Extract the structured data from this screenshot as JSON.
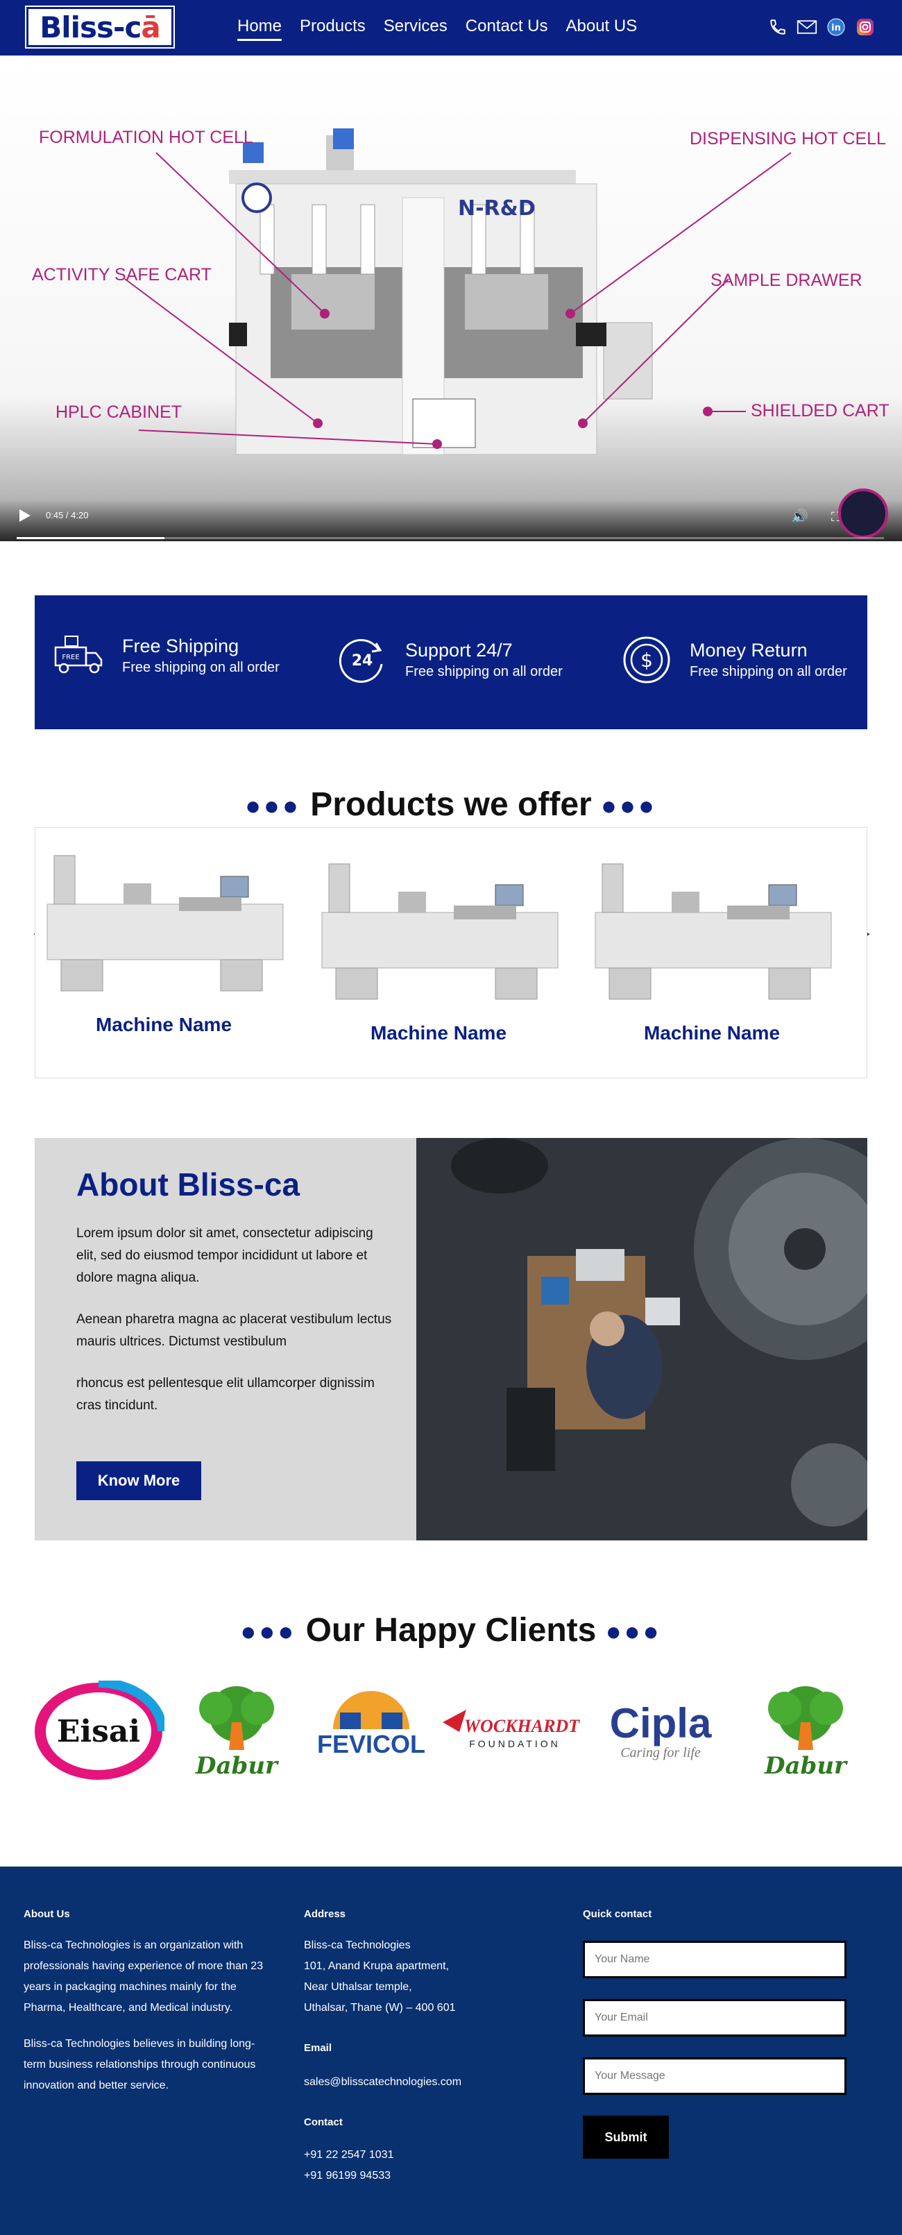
{
  "nav": {
    "logo_main": "Bliss-c",
    "logo_accent": "ā",
    "items": [
      "Home",
      "Products",
      "Services",
      "Contact Us",
      "About US"
    ],
    "active_index": 0,
    "icons": [
      "phone-icon",
      "mail-icon",
      "linkedin-icon",
      "instagram-icon"
    ]
  },
  "hero": {
    "callouts": [
      "FORMULATION HOT CELL",
      "DISPENSING HOT CELL",
      "ACTIVITY SAFE CART",
      "SAMPLE DRAWER",
      "HPLC CABINET",
      "SHIELDED CART"
    ],
    "machine_label": "N-R&D",
    "video_time": "0:45 / 4:20",
    "video_progress": 0.17
  },
  "features": [
    {
      "title": "Free Shipping",
      "sub": "Free shipping on all order",
      "icon": "truck-icon"
    },
    {
      "title": "Support 24/7",
      "sub": "Free shipping on all order",
      "icon": "support-24-icon"
    },
    {
      "title": "Money Return",
      "sub": "Free shipping on all order",
      "icon": "money-return-icon"
    }
  ],
  "products": {
    "title": "Products we offer",
    "items": [
      "Machine Name",
      "Machine Name",
      "Machine Name"
    ]
  },
  "about": {
    "title": "About Bliss-ca",
    "paragraphs": [
      "Lorem ipsum dolor sit amet, consectetur adipiscing elit, sed do eiusmod tempor incididunt ut labore et dolore magna aliqua.",
      "Aenean pharetra magna ac placerat vestibulum lectus mauris ultrices. Dictumst vestibulum",
      "rhoncus est pellentesque elit ullamcorper dignissim cras tincidunt."
    ],
    "button": "Know More"
  },
  "clients": {
    "title": "Our Happy Clients",
    "logos": [
      "Eisai",
      "Dabur",
      "FEVICOL",
      "WOCKHARDT",
      "FOUNDATION",
      "Cipla",
      "Caring for life",
      "Dabur"
    ]
  },
  "footer": {
    "about_head": "About Us",
    "about_p1": "Bliss-ca Technologies is an organization with professionals having experience of more than 23 years in packaging machines mainly for the Pharma, Healthcare, and Medical industry.",
    "about_p2": "Bliss-ca Technologies believes in building long-term business relationships through continuous innovation and better service.",
    "address_head": "Address",
    "address_lines": [
      "Bliss-ca Technologies",
      "101, Anand Krupa apartment,",
      "Near Uthalsar temple,",
      "Uthalsar, Thane (W) – 400 601"
    ],
    "email_head": "Email",
    "email": "sales@blisscatechnologies.com",
    "contact_head": "Contact",
    "phones": [
      "+91 22 2547 1031",
      "+91 96199 94533"
    ],
    "quick_head": "Quick contact",
    "name_placeholder": "Your Name",
    "email_placeholder": "Your Email",
    "message_placeholder": "Your Message",
    "submit": "Submit"
  },
  "colors": {
    "brand": "#0a2183",
    "footer": "#09306f",
    "callout": "#b0217a",
    "about_bg": "#d9d9d9"
  }
}
